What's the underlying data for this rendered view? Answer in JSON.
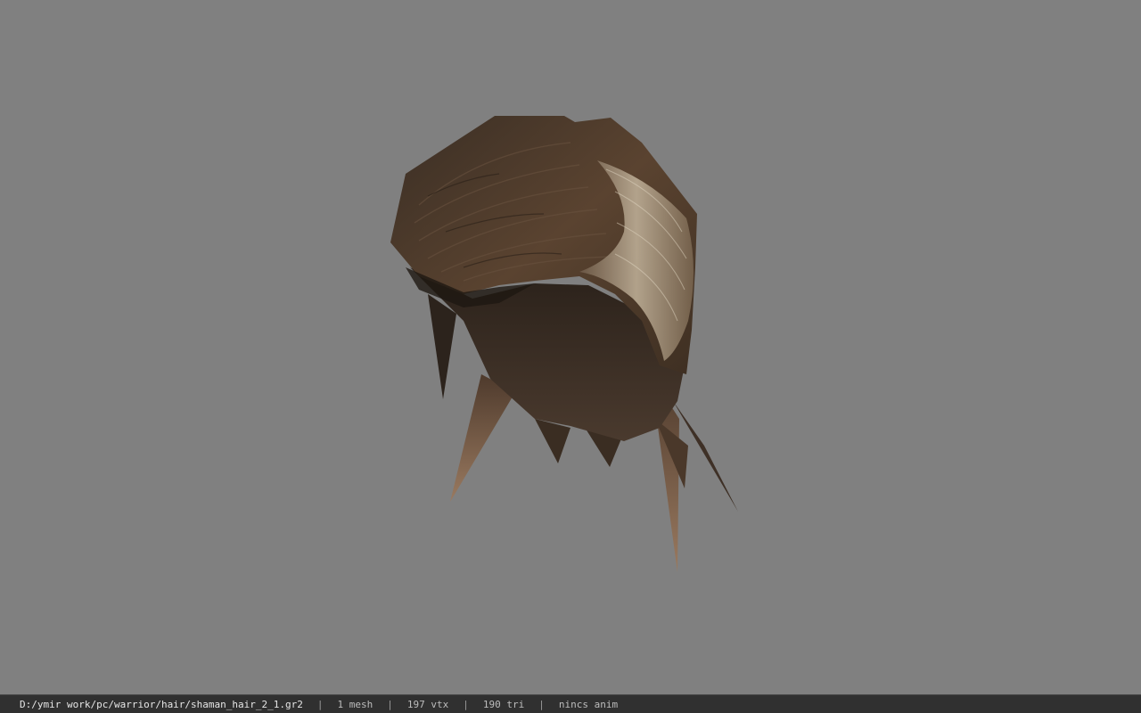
{
  "viewport": {
    "background": "#808080",
    "model": {
      "name": "hair-mesh",
      "colors": {
        "dark": "#2e241c",
        "mid": "#4e3a2a",
        "light": "#6e5640",
        "highlight": "#b9ab92",
        "tip": "#8a6a52"
      }
    }
  },
  "status_bar": {
    "path": "D:/ymir work/pc/warrior/hair/shaman_hair_2_1.gr2",
    "separator": "|",
    "mesh_count": "1 mesh",
    "vertex_count": "197 vtx",
    "triangle_count": "190 tri",
    "anim_status": "nincs anim"
  }
}
